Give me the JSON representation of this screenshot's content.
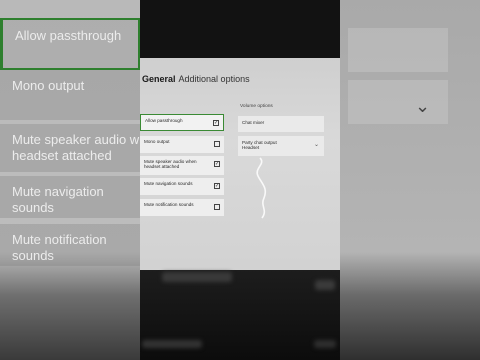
{
  "background": {
    "left_labels": [
      "Allow passthrough",
      "Mono output",
      "Mute speaker audio whe\nheadset attached",
      "Mute navigation sounds",
      "Mute notification sounds"
    ]
  },
  "settings": {
    "header": {
      "title": "General",
      "subtitle": "Additional options"
    },
    "options": [
      {
        "label": "Allow passthrough",
        "checked": true
      },
      {
        "label": "Mono output",
        "checked": false
      },
      {
        "label": "Mute speaker audio when headset attached",
        "checked": true
      },
      {
        "label": "Mute navigation sounds",
        "checked": true
      },
      {
        "label": "Mute notification sounds",
        "checked": false
      }
    ],
    "volume": {
      "title": "Volume options",
      "chat_mixer_label": "Chat mixer",
      "party_chat_label": "Party chat output",
      "party_chat_value": "Headset"
    }
  },
  "colors": {
    "selection": "#3a8a34",
    "panel": "#d6d6d6"
  },
  "icons": {
    "checked": "checkbox-checked-icon",
    "unchecked": "checkbox-empty-icon",
    "dropdown": "chevron-down-icon"
  }
}
